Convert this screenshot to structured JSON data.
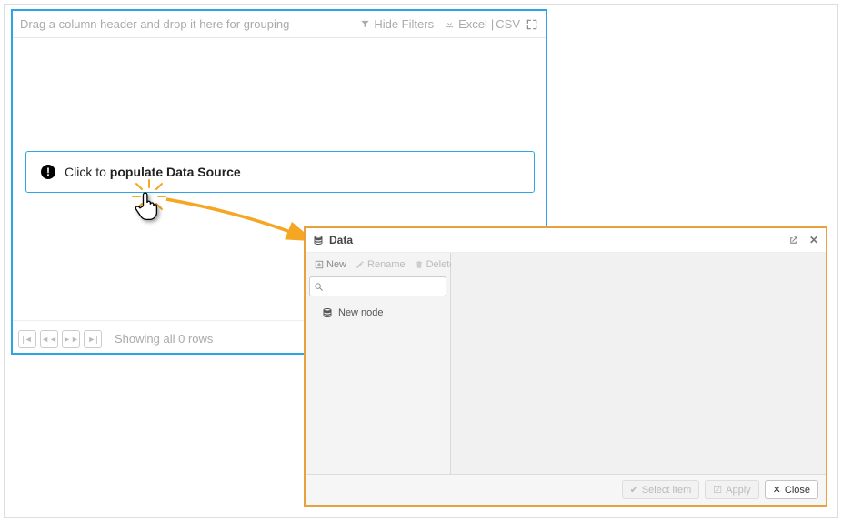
{
  "grid": {
    "drag_hint": "Drag a column header and drop it here for grouping",
    "hide_filters": "Hide Filters",
    "excel": "Excel",
    "csv": "CSV",
    "populate_prefix": "Click to ",
    "populate_bold": "populate Data Source",
    "footer_rows": "Showing all 0 rows",
    "pager": {
      "first": "|◄",
      "prev": "◄◄",
      "next": "►►",
      "last": "►|"
    }
  },
  "modal": {
    "title": "Data",
    "toolbar": {
      "new": "New",
      "rename": "Rename",
      "delete": "Delete"
    },
    "search_placeholder": "",
    "tree": {
      "new_node": "New node"
    },
    "footer": {
      "select": "Select item",
      "apply": "Apply",
      "close": "Close"
    }
  }
}
